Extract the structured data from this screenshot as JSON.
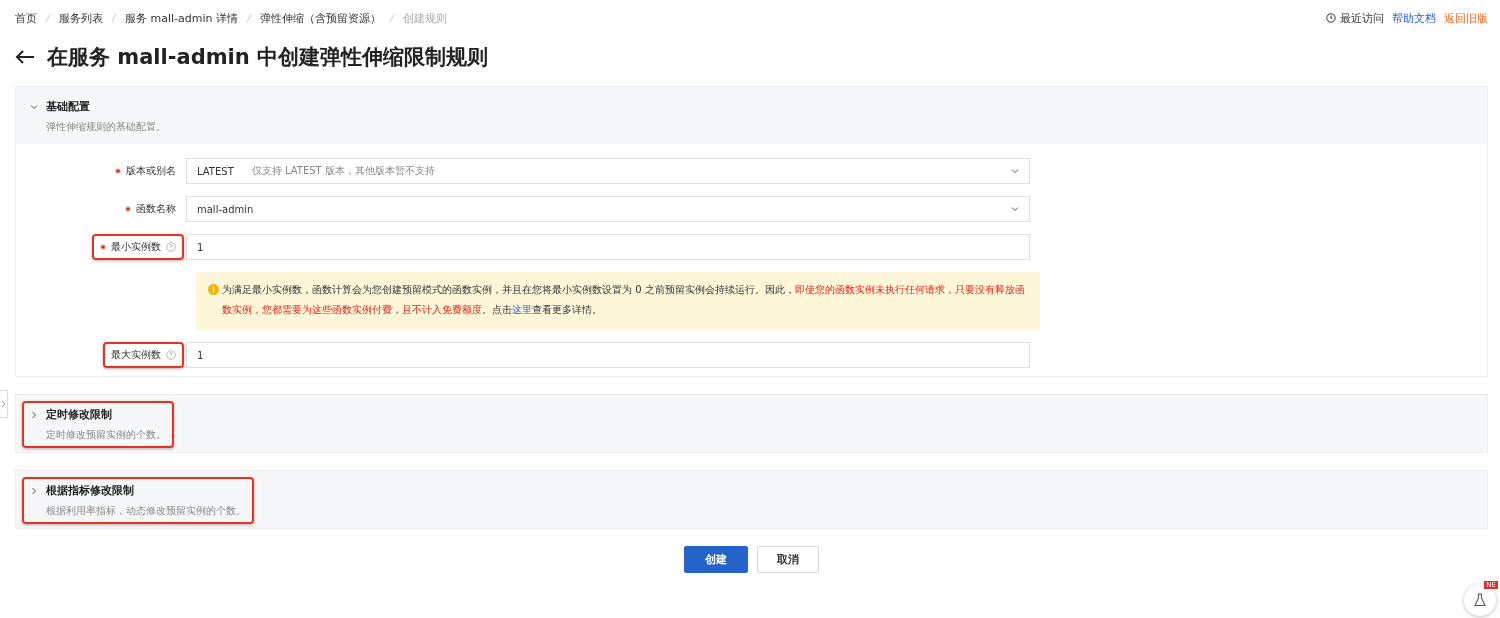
{
  "breadcrumb": [
    {
      "label": "首页",
      "current": false
    },
    {
      "label": "服务列表",
      "current": false
    },
    {
      "label": "服务 mall-admin 详情",
      "current": false
    },
    {
      "label": "弹性伸缩（含预留资源）",
      "current": false
    },
    {
      "label": "创建规则",
      "current": true
    }
  ],
  "top_links": [
    {
      "kind": "recent",
      "label": "最近访问"
    },
    {
      "kind": "help",
      "label": "帮助文档"
    },
    {
      "kind": "old",
      "label": "返回旧版"
    }
  ],
  "title": "在服务 mall-admin 中创建弹性伸缩限制规则",
  "sections": [
    {
      "title": "基础配置",
      "description": "弹性伸缩规则的基础配置。",
      "expanded": true,
      "highlighted": false,
      "fields": [
        {
          "kind": "select",
          "label": "版本或别名",
          "required": true,
          "help": false,
          "highlighted": false,
          "value": "LATEST",
          "note": "仅支持 LATEST 版本，其他版本暂不支持"
        },
        {
          "kind": "select",
          "label": "函数名称",
          "required": true,
          "help": false,
          "highlighted": false,
          "value": "mall-admin"
        },
        {
          "kind": "input",
          "label": "最小实例数",
          "required": true,
          "help": true,
          "highlighted": true,
          "value": "1"
        },
        {
          "kind": "notice",
          "parts": [
            {
              "kind": "normal",
              "text": "为满足最小实例数，函数计算会为您创建预留模式的函数实例，并且在您将最小实例数设置为 0 之前预留实例会持续运行。因此，"
            },
            {
              "kind": "danger",
              "text": "即使您的函数实例未执行任何请求，只要没有释放函数实例，您都需要为这些函数实例付费，且不计入免费额度"
            },
            {
              "kind": "normal",
              "text": "。点击"
            },
            {
              "kind": "link",
              "text": "这里"
            },
            {
              "kind": "normal",
              "text": "查看更多详情。"
            }
          ]
        },
        {
          "kind": "input",
          "label": "最大实例数",
          "required": false,
          "help": true,
          "highlighted": true,
          "value": "1"
        }
      ]
    },
    {
      "title": "定时修改限制",
      "description": "定时修改预留实例的个数。",
      "expanded": false,
      "highlighted": true
    },
    {
      "title": "根据指标修改限制",
      "description": "根据利用率指标，动态修改预留实例的个数。",
      "expanded": false,
      "highlighted": true
    }
  ],
  "buttons": [
    {
      "kind": "primary",
      "label": "创建"
    },
    {
      "kind": "default",
      "label": "取消"
    }
  ],
  "badge": "NE"
}
